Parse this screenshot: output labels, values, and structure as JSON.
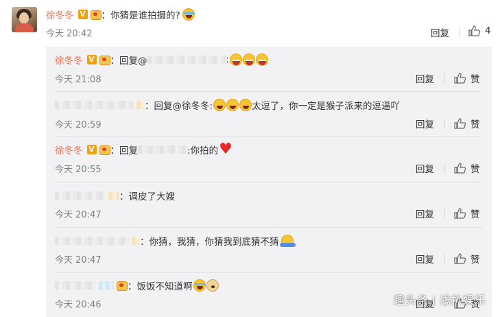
{
  "main": {
    "username": "徐冬冬",
    "vip_badge": "V",
    "text": "：你猜是谁拍摄的?",
    "time": "今天 20:42",
    "reply_label": "回复",
    "like_count": "4"
  },
  "replies": [
    {
      "username": "徐冬冬",
      "has_badges": true,
      "prefix": "：回复@",
      "text": "",
      "suffix": ":",
      "emojis": [
        "grin",
        "grin",
        "grin"
      ],
      "time": "今天 21:08",
      "reply_label": "回复",
      "like_label": "赞"
    },
    {
      "username": "",
      "has_badges": false,
      "prefix": "：回复@徐冬冬:",
      "text": "太逗了，你一定是猴子派来的逗逼吖",
      "emojis": [
        "laugh",
        "laugh",
        "laugh"
      ],
      "time": "今天 20:59",
      "reply_label": "回复",
      "like_label": "赞"
    },
    {
      "username": "徐冬冬",
      "has_badges": true,
      "prefix": "：回复",
      "text": ":你拍的",
      "emojis": [
        "heart"
      ],
      "time": "今天 20:55",
      "reply_label": "回复",
      "like_label": "赞"
    },
    {
      "username": "",
      "has_badges": false,
      "prefix": "：",
      "text": "调皮了大嫂",
      "emojis": [],
      "time": "今天 20:47",
      "reply_label": "回复",
      "like_label": "赞"
    },
    {
      "username": "",
      "has_badges": false,
      "prefix": "：",
      "text": "你猜，我猜，你猜我到底猜不猜",
      "emojis": [
        "shrug"
      ],
      "time": "今天 20:47",
      "reply_label": "回复",
      "like_label": "赞"
    },
    {
      "username": "",
      "has_badges": false,
      "prefix": "：",
      "text": "饭饭不知道啊",
      "emojis": [
        "tears",
        "doge"
      ],
      "time": "今天 20:46",
      "reply_label": "回复",
      "like_label": "赞"
    }
  ],
  "watermark": "趣头条 | 浅扒娱乐",
  "colors": {
    "username": "#eb7350",
    "reply_bg": "#f2f2f5",
    "meta": "#808080",
    "vip": "#f2a00b"
  },
  "icons": {
    "like": "thumbs-up-icon",
    "vip": "vip-badge-icon",
    "fan": "fan-badge-icon"
  }
}
